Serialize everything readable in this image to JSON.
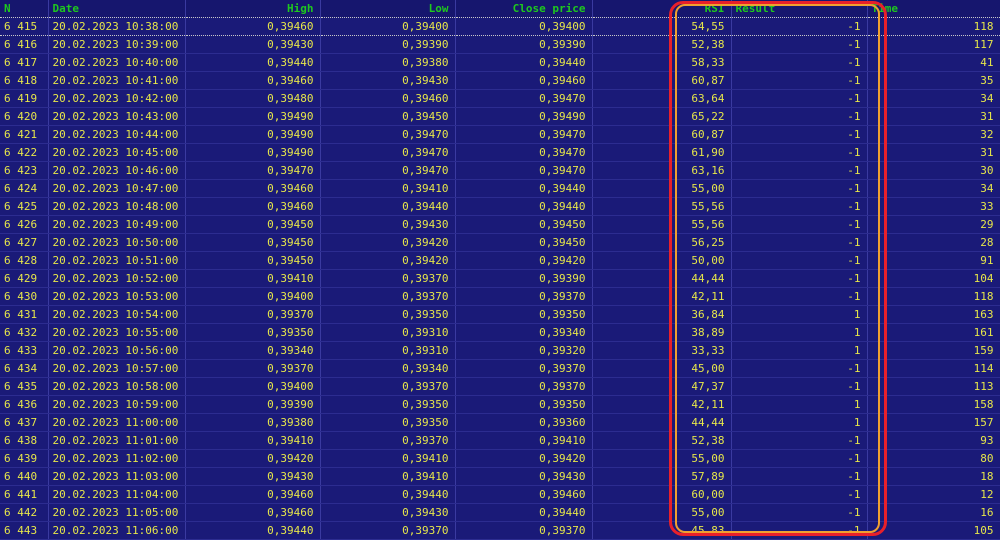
{
  "columns": {
    "n": "N",
    "date": "Date",
    "high": "High",
    "low": "Low",
    "close": "Close price",
    "rsi": "RSI",
    "result": "Result",
    "time": "Time"
  },
  "rows": [
    [
      "6 415",
      "20.02.2023 10:38:00",
      "0,39460",
      "0,39400",
      "0,39400",
      "54,55",
      "-1",
      "118"
    ],
    [
      "6 416",
      "20.02.2023 10:39:00",
      "0,39430",
      "0,39390",
      "0,39390",
      "52,38",
      "-1",
      "117"
    ],
    [
      "6 417",
      "20.02.2023 10:40:00",
      "0,39440",
      "0,39380",
      "0,39440",
      "58,33",
      "-1",
      "41"
    ],
    [
      "6 418",
      "20.02.2023 10:41:00",
      "0,39460",
      "0,39430",
      "0,39460",
      "60,87",
      "-1",
      "35"
    ],
    [
      "6 419",
      "20.02.2023 10:42:00",
      "0,39480",
      "0,39460",
      "0,39470",
      "63,64",
      "-1",
      "34"
    ],
    [
      "6 420",
      "20.02.2023 10:43:00",
      "0,39490",
      "0,39450",
      "0,39490",
      "65,22",
      "-1",
      "31"
    ],
    [
      "6 421",
      "20.02.2023 10:44:00",
      "0,39490",
      "0,39470",
      "0,39470",
      "60,87",
      "-1",
      "32"
    ],
    [
      "6 422",
      "20.02.2023 10:45:00",
      "0,39490",
      "0,39470",
      "0,39470",
      "61,90",
      "-1",
      "31"
    ],
    [
      "6 423",
      "20.02.2023 10:46:00",
      "0,39470",
      "0,39470",
      "0,39470",
      "63,16",
      "-1",
      "30"
    ],
    [
      "6 424",
      "20.02.2023 10:47:00",
      "0,39460",
      "0,39410",
      "0,39440",
      "55,00",
      "-1",
      "34"
    ],
    [
      "6 425",
      "20.02.2023 10:48:00",
      "0,39460",
      "0,39440",
      "0,39440",
      "55,56",
      "-1",
      "33"
    ],
    [
      "6 426",
      "20.02.2023 10:49:00",
      "0,39450",
      "0,39430",
      "0,39450",
      "55,56",
      "-1",
      "29"
    ],
    [
      "6 427",
      "20.02.2023 10:50:00",
      "0,39450",
      "0,39420",
      "0,39450",
      "56,25",
      "-1",
      "28"
    ],
    [
      "6 428",
      "20.02.2023 10:51:00",
      "0,39450",
      "0,39420",
      "0,39420",
      "50,00",
      "-1",
      "91"
    ],
    [
      "6 429",
      "20.02.2023 10:52:00",
      "0,39410",
      "0,39370",
      "0,39390",
      "44,44",
      "-1",
      "104"
    ],
    [
      "6 430",
      "20.02.2023 10:53:00",
      "0,39400",
      "0,39370",
      "0,39370",
      "42,11",
      "-1",
      "118"
    ],
    [
      "6 431",
      "20.02.2023 10:54:00",
      "0,39370",
      "0,39350",
      "0,39350",
      "36,84",
      "1",
      "163"
    ],
    [
      "6 432",
      "20.02.2023 10:55:00",
      "0,39350",
      "0,39310",
      "0,39340",
      "38,89",
      "1",
      "161"
    ],
    [
      "6 433",
      "20.02.2023 10:56:00",
      "0,39340",
      "0,39310",
      "0,39320",
      "33,33",
      "1",
      "159"
    ],
    [
      "6 434",
      "20.02.2023 10:57:00",
      "0,39370",
      "0,39340",
      "0,39370",
      "45,00",
      "-1",
      "114"
    ],
    [
      "6 435",
      "20.02.2023 10:58:00",
      "0,39400",
      "0,39370",
      "0,39370",
      "47,37",
      "-1",
      "113"
    ],
    [
      "6 436",
      "20.02.2023 10:59:00",
      "0,39390",
      "0,39350",
      "0,39350",
      "42,11",
      "1",
      "158"
    ],
    [
      "6 437",
      "20.02.2023 11:00:00",
      "0,39380",
      "0,39350",
      "0,39360",
      "44,44",
      "1",
      "157"
    ],
    [
      "6 438",
      "20.02.2023 11:01:00",
      "0,39410",
      "0,39370",
      "0,39410",
      "52,38",
      "-1",
      "93"
    ],
    [
      "6 439",
      "20.02.2023 11:02:00",
      "0,39420",
      "0,39410",
      "0,39420",
      "55,00",
      "-1",
      "80"
    ],
    [
      "6 440",
      "20.02.2023 11:03:00",
      "0,39430",
      "0,39410",
      "0,39430",
      "57,89",
      "-1",
      "18"
    ],
    [
      "6 441",
      "20.02.2023 11:04:00",
      "0,39460",
      "0,39440",
      "0,39460",
      "60,00",
      "-1",
      "12"
    ],
    [
      "6 442",
      "20.02.2023 11:05:00",
      "0,39460",
      "0,39430",
      "0,39440",
      "55,00",
      "-1",
      "16"
    ],
    [
      "6 443",
      "20.02.2023 11:06:00",
      "0,39440",
      "0,39370",
      "0,39370",
      "45,83",
      "-1",
      "105"
    ]
  ],
  "colors": {
    "background": "#1a1a78",
    "header_text": "#1ec81e",
    "cell_text": "#e6e64a",
    "highlight_outer": "#e8202a",
    "highlight_inner": "#f0a030"
  }
}
